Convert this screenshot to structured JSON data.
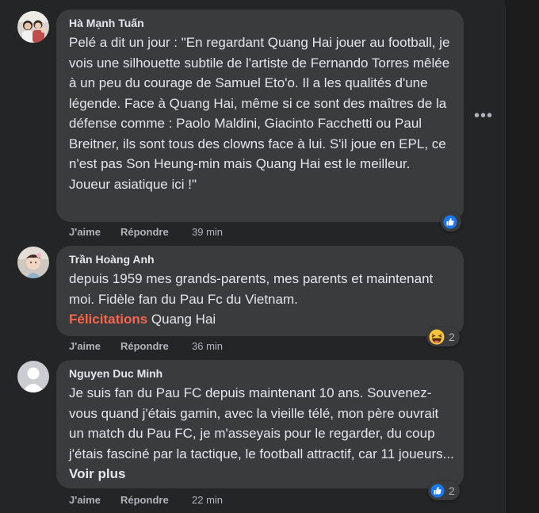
{
  "comments": [
    {
      "author": "Hà Mạnh Tuấn",
      "text": "Pelé a dit un jour : \"En regardant Quang Hai jouer au football, je vois une silhouette subtile de l'artiste de Fernando Torres mêlée à un peu du courage de Samuel Eto'o. Il a les qualités d'une légende. Face à Quang Hai, même si ce sont des maîtres de la défense comme : Paolo Maldini, Giacinto Facchetti ou Paul Breitner, ils sont tous des clowns face à lui. S'il joue en EPL, ce n'est pas Son Heung-min mais Quang Hai est le meilleur. Joueur asiatique ici !\"",
      "like_label": "J'aime",
      "reply_label": "Répondre",
      "time": "39 min",
      "reaction_icon": "like-icon",
      "reaction_count": ""
    },
    {
      "author": "Trần Hoàng Anh",
      "text_before": "depuis 1959 mes grands-parents, mes parents et maintenant moi. Fidèle fan du Pau Fc du Vietnam.",
      "highlight": "Félicitations",
      "text_after": " Quang Hai",
      "like_label": "J'aime",
      "reply_label": "Répondre",
      "time": "36 min",
      "reaction_icon": "laughing-emoji-icon",
      "reaction_count": "2"
    },
    {
      "author": "Nguyen Duc Minh",
      "text": "Je suis fan du Pau FC depuis maintenant 10 ans. Souvenez-vous quand j'étais gamin, avec la vieille télé, mon père ouvrait un match du Pau FC, je m'asseyais pour le regarder, du coup j'étais fasciné par la tactique, le football attractif, car 11 joueurs... ",
      "see_more": "Voir plus",
      "like_label": "J'aime",
      "reply_label": "Répondre",
      "time": "22 min",
      "reaction_icon": "like-icon",
      "reaction_count": "2"
    }
  ],
  "colors": {
    "background": "#242526",
    "bubble": "#3a3b3c",
    "text": "#e4e6eb",
    "secondary": "#b0b3b8",
    "highlight": "#f4664d",
    "like_blue": "#1877f2"
  }
}
